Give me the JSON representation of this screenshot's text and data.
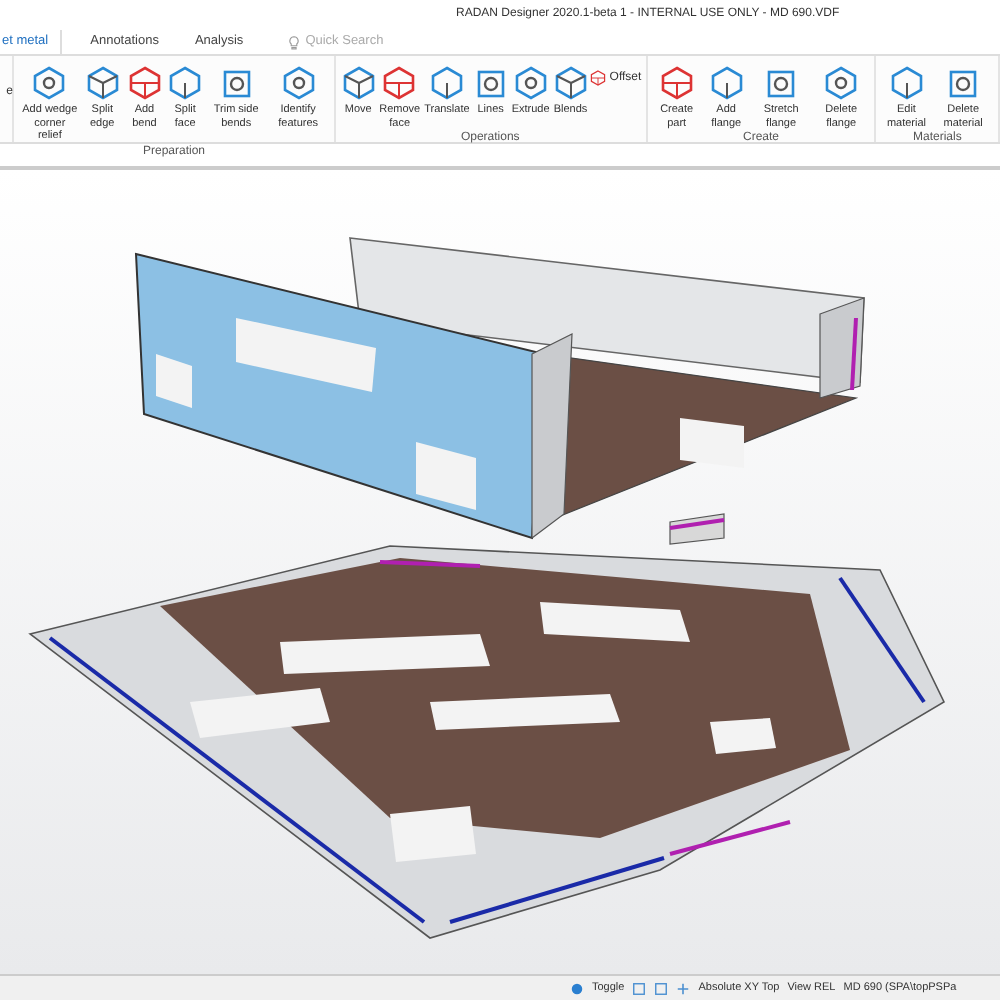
{
  "window": {
    "title": "RADAN Designer 2020.1-beta 1 - INTERNAL USE ONLY - MD 690.VDF"
  },
  "tabs": [
    {
      "label": "et metal",
      "selected": true
    },
    {
      "label": "Annotations",
      "selected": false
    },
    {
      "label": "Analysis",
      "selected": false
    }
  ],
  "search": {
    "placeholder": "Quick Search"
  },
  "ribbon": {
    "cut_group": {
      "label": "e"
    },
    "groups": [
      {
        "label": "Preparation",
        "buttons": [
          {
            "label": "Add wedge corner relief",
            "kind": "large"
          },
          {
            "label": "Split edge",
            "kind": "large"
          },
          {
            "label": "Add bend",
            "kind": "large"
          },
          {
            "label": "Split face",
            "kind": "large"
          },
          {
            "label": "Trim side bends",
            "kind": "large"
          },
          {
            "label": "Identify features",
            "kind": "large"
          }
        ]
      },
      {
        "label": "Operations",
        "buttons": [
          {
            "label": "Move",
            "kind": "large"
          },
          {
            "label": "Remove face",
            "kind": "large"
          },
          {
            "label": "Translate",
            "kind": "large"
          },
          {
            "label": "Lines",
            "kind": "large"
          },
          {
            "label": "Extrude",
            "kind": "large"
          },
          {
            "label": "Blends",
            "kind": "large"
          },
          {
            "label": "Offset",
            "kind": "small"
          }
        ]
      },
      {
        "label": "Create",
        "buttons": [
          {
            "label": "Create part",
            "kind": "large"
          },
          {
            "label": "Add flange",
            "kind": "large"
          },
          {
            "label": "Stretch flange",
            "kind": "large"
          },
          {
            "label": "Delete flange",
            "kind": "large"
          }
        ]
      },
      {
        "label": "Materials",
        "buttons": [
          {
            "label": "Edit material",
            "kind": "large"
          },
          {
            "label": "Delete material",
            "kind": "large"
          }
        ]
      }
    ]
  },
  "status_bar": {
    "toggle": "Toggle",
    "mode": "Absolute XY Top",
    "view": "View REL",
    "file": "MD 690 (SPA\\topPSPa"
  }
}
